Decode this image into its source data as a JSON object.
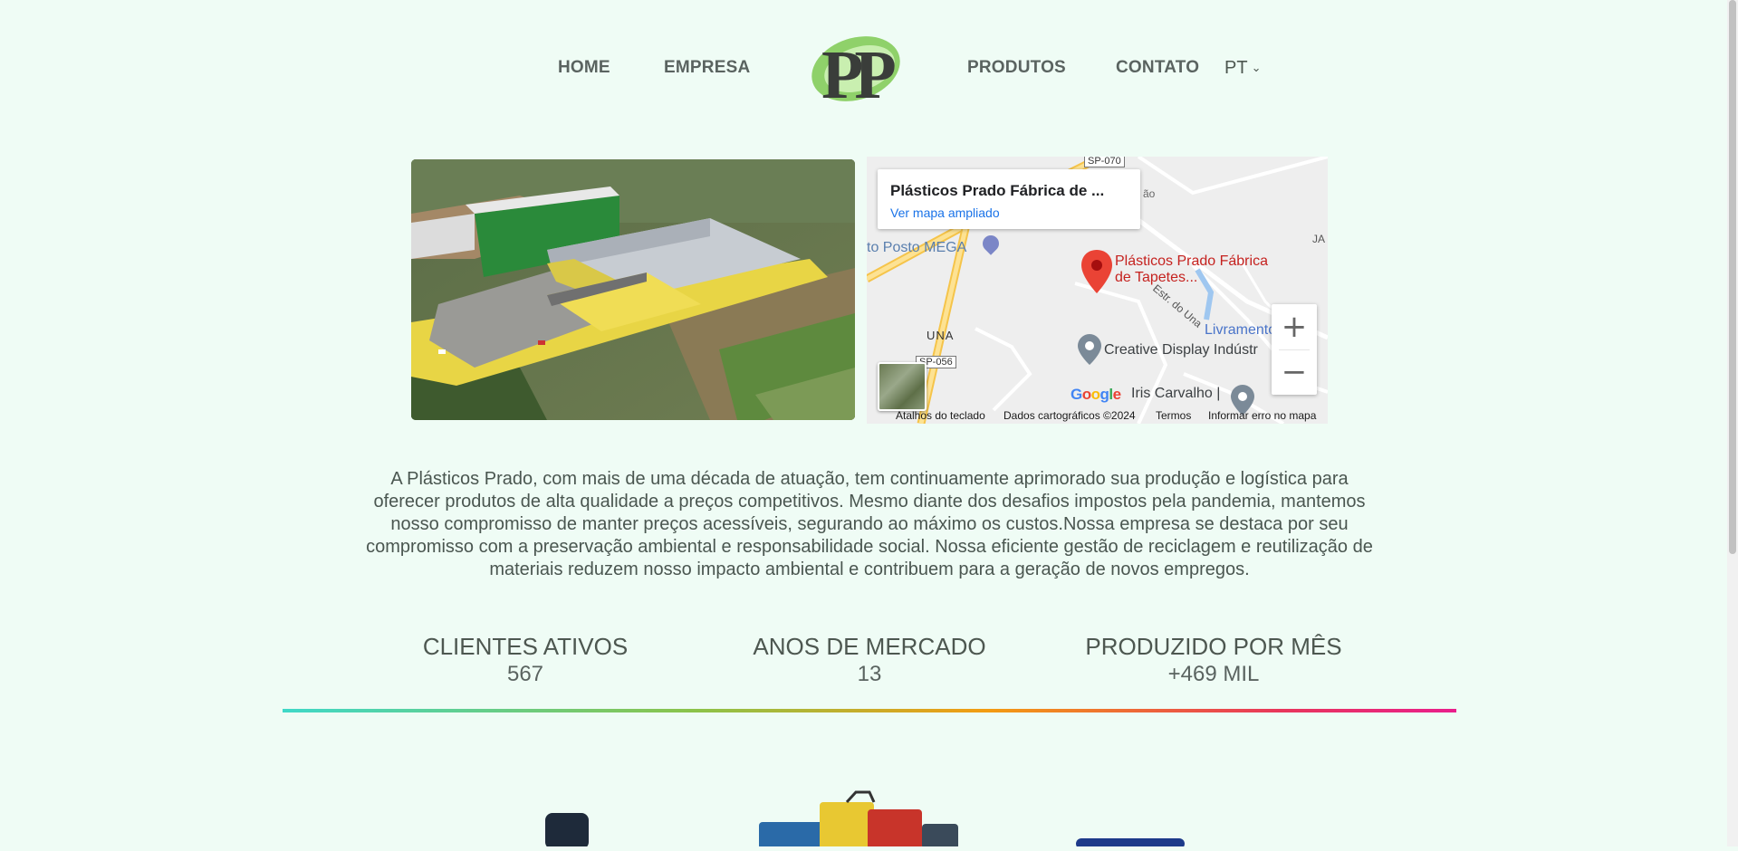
{
  "nav": {
    "items": [
      {
        "label": "HOME"
      },
      {
        "label": "EMPRESA"
      },
      {
        "label": "PRODUTOS"
      },
      {
        "label": "CONTATO"
      }
    ],
    "logo_text": "PP",
    "language": "PT"
  },
  "map": {
    "card_title": "Plásticos Prado Fábrica de ...",
    "card_link": "Ver mapa ampliado",
    "marker_label_line1": "Plásticos Prado Fábrica",
    "marker_label_line2": "de Tapetes...",
    "places": {
      "posto": "to Posto MEGA",
      "una": "UNA",
      "creative": "Creative Display Indústr",
      "livramento": "Livramento",
      "iris": "Iris Carvalho |",
      "jaj": "JA",
      "sp070": "SP-070",
      "sp056": "SP-056",
      "estr_una": "Estr. do Una",
      "ao": "ão"
    },
    "google_logo": "Google",
    "footer": {
      "shortcuts": "Atalhos do teclado",
      "data": "Dados cartográficos ©2024",
      "terms": "Termos",
      "report": "Informar erro no mapa"
    },
    "zoom_in": "+",
    "zoom_out": "−"
  },
  "description": "A Plásticos Prado, com mais de uma década de atuação, tem continuamente aprimorado sua produção e logística para oferecer produtos de alta qualidade a preços competitivos. Mesmo diante dos desafios impostos pela pandemia, mantemos nosso compromisso de manter preços acessíveis, segurando ao máximo os custos.Nossa empresa se destaca por seu compromisso com a preservação ambiental e responsabilidade social. Nossa eficiente gestão de reciclagem e reutilização de materiais reduzem nosso impacto ambiental e contribuem para a geração de novos empregos.",
  "stats": [
    {
      "label": "CLIENTES ATIVOS",
      "value": "567"
    },
    {
      "label": "ANOS DE MERCADO",
      "value": "13"
    },
    {
      "label": "PRODUZIDO POR MÊS",
      "value": "+469 MIL"
    }
  ],
  "colors": {
    "background": "#effcf5",
    "nav_text": "#5a6360",
    "logo_green": "#8fd16a",
    "map_link": "#1a73e8",
    "marker_red": "#ea4335"
  }
}
